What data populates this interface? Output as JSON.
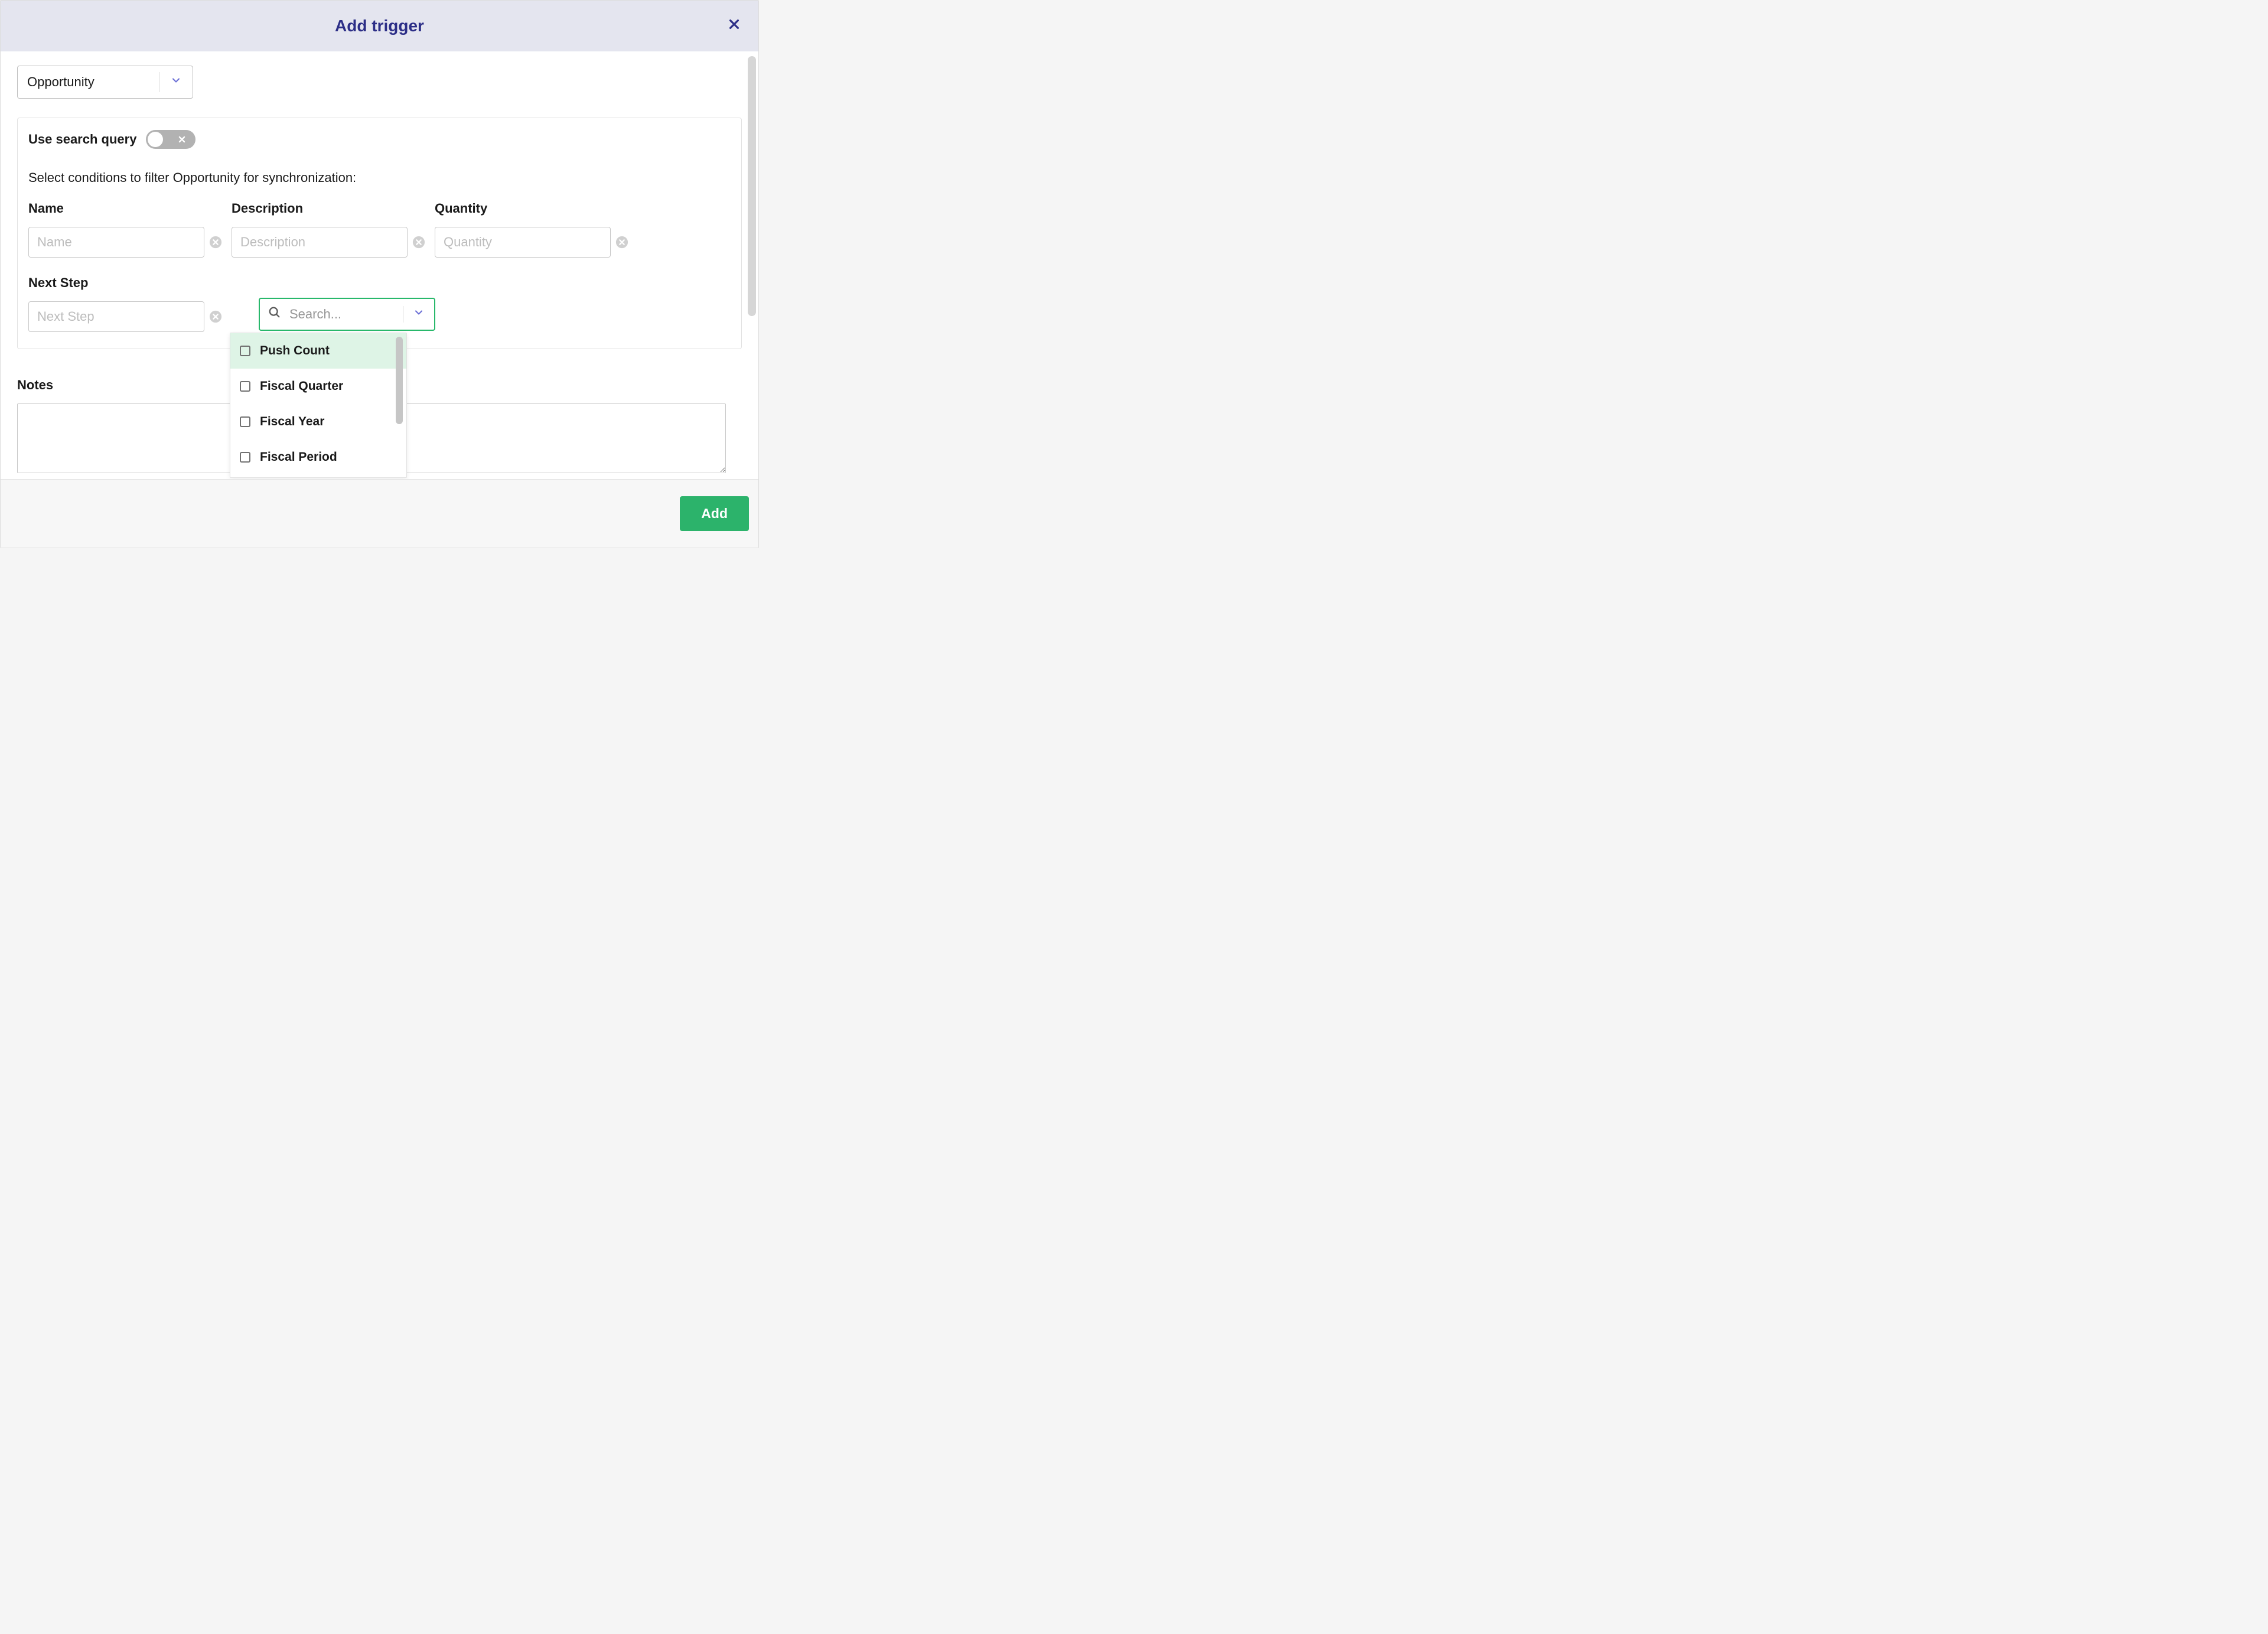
{
  "modal": {
    "title": "Add trigger",
    "object_select": {
      "value": "Opportunity"
    },
    "conditions": {
      "toggle_label": "Use search query",
      "toggle_on": false,
      "instruction": "Select conditions to filter Opportunity for synchronization:",
      "fields": {
        "name": {
          "label": "Name",
          "placeholder": "Name"
        },
        "description": {
          "label": "Description",
          "placeholder": "Description"
        },
        "quantity": {
          "label": "Quantity",
          "placeholder": "Quantity"
        },
        "next_step": {
          "label": "Next Step",
          "placeholder": "Next Step"
        }
      },
      "search": {
        "placeholder": "Search..."
      },
      "dropdown_options": [
        {
          "label": "Push Count",
          "highlighted": true
        },
        {
          "label": "Fiscal Quarter",
          "highlighted": false
        },
        {
          "label": "Fiscal Year",
          "highlighted": false
        },
        {
          "label": "Fiscal Period",
          "highlighted": false
        }
      ]
    },
    "notes": {
      "label": "Notes",
      "value": ""
    },
    "footer": {
      "add_label": "Add"
    }
  }
}
